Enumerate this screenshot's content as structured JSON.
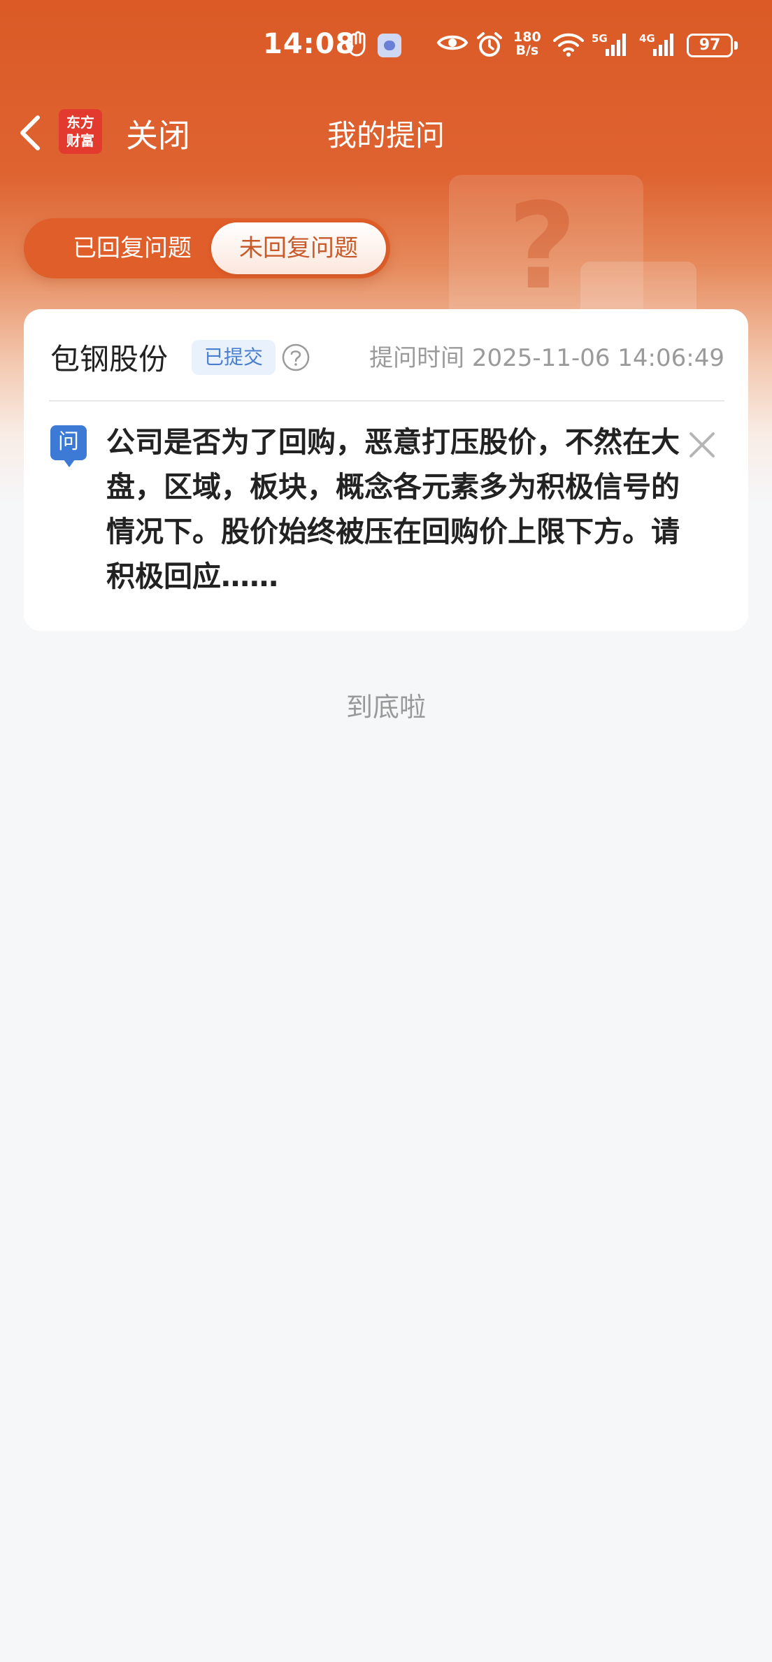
{
  "status_bar": {
    "time": "14:08",
    "speed_top": "180",
    "speed_bottom": "B/s",
    "sig1_label": "5G",
    "sig2_label": "4G",
    "battery": "97"
  },
  "nav": {
    "brand_logo": "东方\n财富",
    "close_label": "关闭",
    "title": "我的提问"
  },
  "tabs": [
    {
      "label": "已回复问题",
      "active": false
    },
    {
      "label": "未回复问题",
      "active": true
    }
  ],
  "question": {
    "stock_name": "包钢股份",
    "status": "已提交",
    "ask_time": "提问时间 2025-11-06 14:06:49",
    "badge": "问",
    "text": "公司是否为了回购，恶意打压股价，不然在大盘，区域，板块，概念各元素多为积极信号的情况下。股价始终被压在回购价上限下方。请积极回应……"
  },
  "footer": {
    "end_text": "到底啦"
  },
  "colors": {
    "header": "#db5a26",
    "tab_active_text": "#c85a2a",
    "badge_blue": "#3c7ad6",
    "status_badge_bg": "#e9f1fc"
  }
}
